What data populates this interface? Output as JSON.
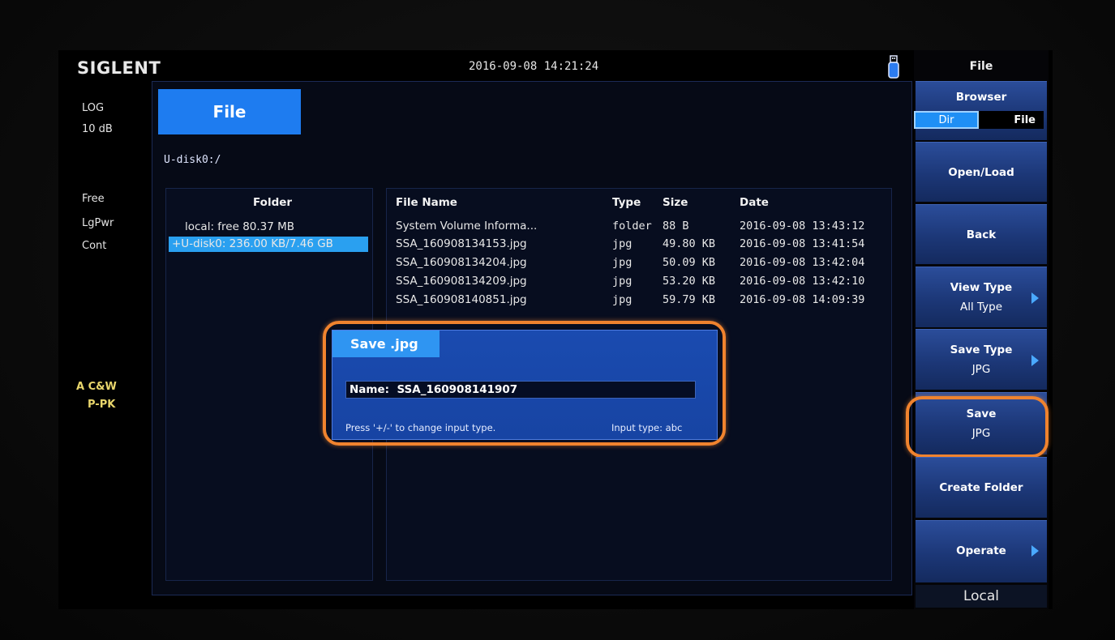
{
  "header": {
    "logo": "SIGLENT",
    "datetime": "2016-09-08  14:21:24"
  },
  "left_status": {
    "scale": "LOG",
    "ref": "10 dB",
    "free": "Free",
    "lgpwr": "LgPwr",
    "cont": "Cont",
    "trace_mode": "A C&W",
    "detector": "P-PK"
  },
  "file_tab": "File",
  "path": "U-disk0:/",
  "folders": {
    "header": "Folder",
    "items": [
      "local: free 80.37 MB",
      "+U-disk0: 236.00 KB/7.46 GB"
    ]
  },
  "files": {
    "headers": {
      "name": "File Name",
      "type": "Type",
      "size": "Size",
      "date": "Date"
    },
    "rows": [
      {
        "name": "System Volume Informa...",
        "type": "folder",
        "size": "88 B",
        "date": "2016-09-08 13:43:12"
      },
      {
        "name": "SSA_160908134153.jpg",
        "type": "jpg",
        "size": "49.80 KB",
        "date": "2016-09-08 13:41:54"
      },
      {
        "name": "SSA_160908134204.jpg",
        "type": "jpg",
        "size": "50.09 KB",
        "date": "2016-09-08 13:42:04"
      },
      {
        "name": "SSA_160908134209.jpg",
        "type": "jpg",
        "size": "53.20 KB",
        "date": "2016-09-08 13:42:10"
      },
      {
        "name": "SSA_160908140851.jpg",
        "type": "jpg",
        "size": "59.79 KB",
        "date": "2016-09-08 14:09:39"
      }
    ]
  },
  "dialog": {
    "title": "Save .jpg",
    "name_label": "Name:",
    "name_value": "SSA_160908141907",
    "hint": "Press '+/-' to change input type.",
    "input_type": "Input type:  abc"
  },
  "menu": {
    "title": "File",
    "browser": {
      "label": "Browser",
      "dir": "Dir",
      "file": "File"
    },
    "open_load": "Open/Load",
    "back": "Back",
    "view_type": {
      "label": "View Type",
      "value": "All Type"
    },
    "save_type": {
      "label": "Save Type",
      "value": "JPG"
    },
    "save": {
      "label": "Save",
      "value": "JPG"
    },
    "create_folder": "Create Folder",
    "operate": "Operate",
    "status": "Local"
  },
  "colors": {
    "accent_blue": "#1e7cf0",
    "selection_blue": "#2aa0f0",
    "highlight_orange": "#f0832e",
    "menu_blue": "#1c3777"
  }
}
